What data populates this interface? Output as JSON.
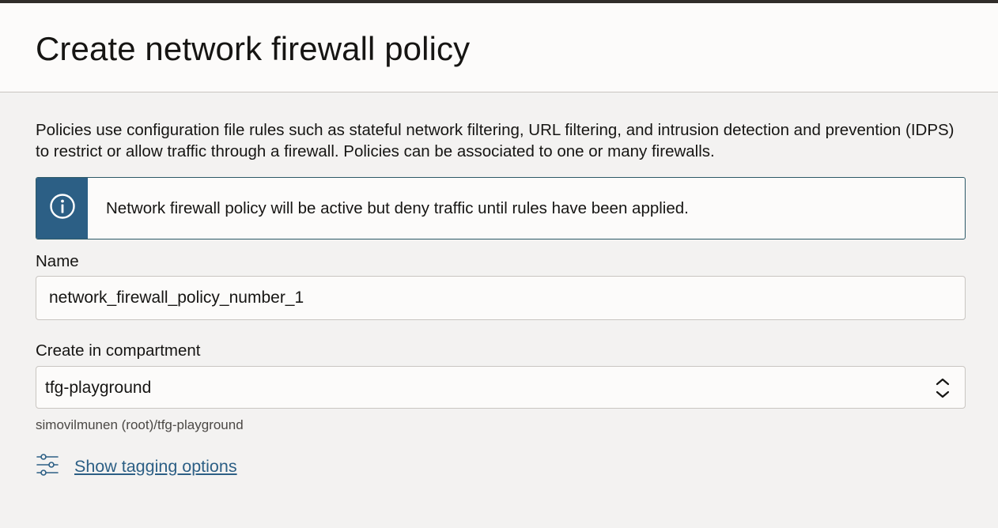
{
  "header": {
    "title": "Create network firewall policy"
  },
  "intro": {
    "text": "Policies use configuration file rules such as stateful network filtering, URL filtering, and intrusion detection and prevention (IDPS) to restrict or allow traffic through a firewall. Policies can be associated to one or many firewalls."
  },
  "notice": {
    "icon": "info-icon",
    "text": "Network firewall policy will be active but deny traffic until rules have been applied."
  },
  "form": {
    "name_label": "Name",
    "name_value": "network_firewall_policy_number_1",
    "compartment_label": "Create in compartment",
    "compartment_value": "tfg-playground",
    "compartment_path": "simovilmunen (root)/tfg-playground",
    "tagging_icon": "sliders-icon",
    "tagging_link": "Show tagging options"
  },
  "colors": {
    "accent": "#2c5f85",
    "page_background": "#f3f2f1",
    "header_background": "#fcfbfa"
  }
}
